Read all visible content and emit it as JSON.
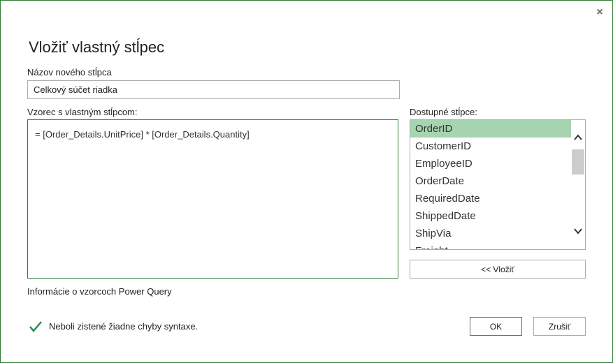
{
  "dialog": {
    "title": "Vložiť vlastný stĺpec",
    "close_icon_glyph": "×"
  },
  "name_field": {
    "label": "Názov nového stĺpca",
    "value": "Celkový súčet riadka"
  },
  "formula": {
    "label": "Vzorec s vlastným stĺpcom:",
    "value": "=  [Order_Details.UnitPrice] * [Order_Details.Quantity]"
  },
  "available_columns": {
    "label": "Dostupné stĺpce:",
    "items": [
      "OrderID",
      "CustomerID",
      "EmployeeID",
      "OrderDate",
      "RequiredDate",
      "ShippedDate",
      "ShipVia",
      "Freight"
    ],
    "selected": "OrderID"
  },
  "buttons": {
    "insert": "<< Vložiť",
    "ok": "OK",
    "cancel": "Zrušiť"
  },
  "help_link": "Informácie o vzorcoch Power Query",
  "status": {
    "text": "Neboli zistené žiadne chyby syntaxe.",
    "icon": "checkmark-icon",
    "color": "#2e8b57"
  },
  "colors": {
    "accent_border": "#2e7d32",
    "selection": "#a6d4b0"
  }
}
